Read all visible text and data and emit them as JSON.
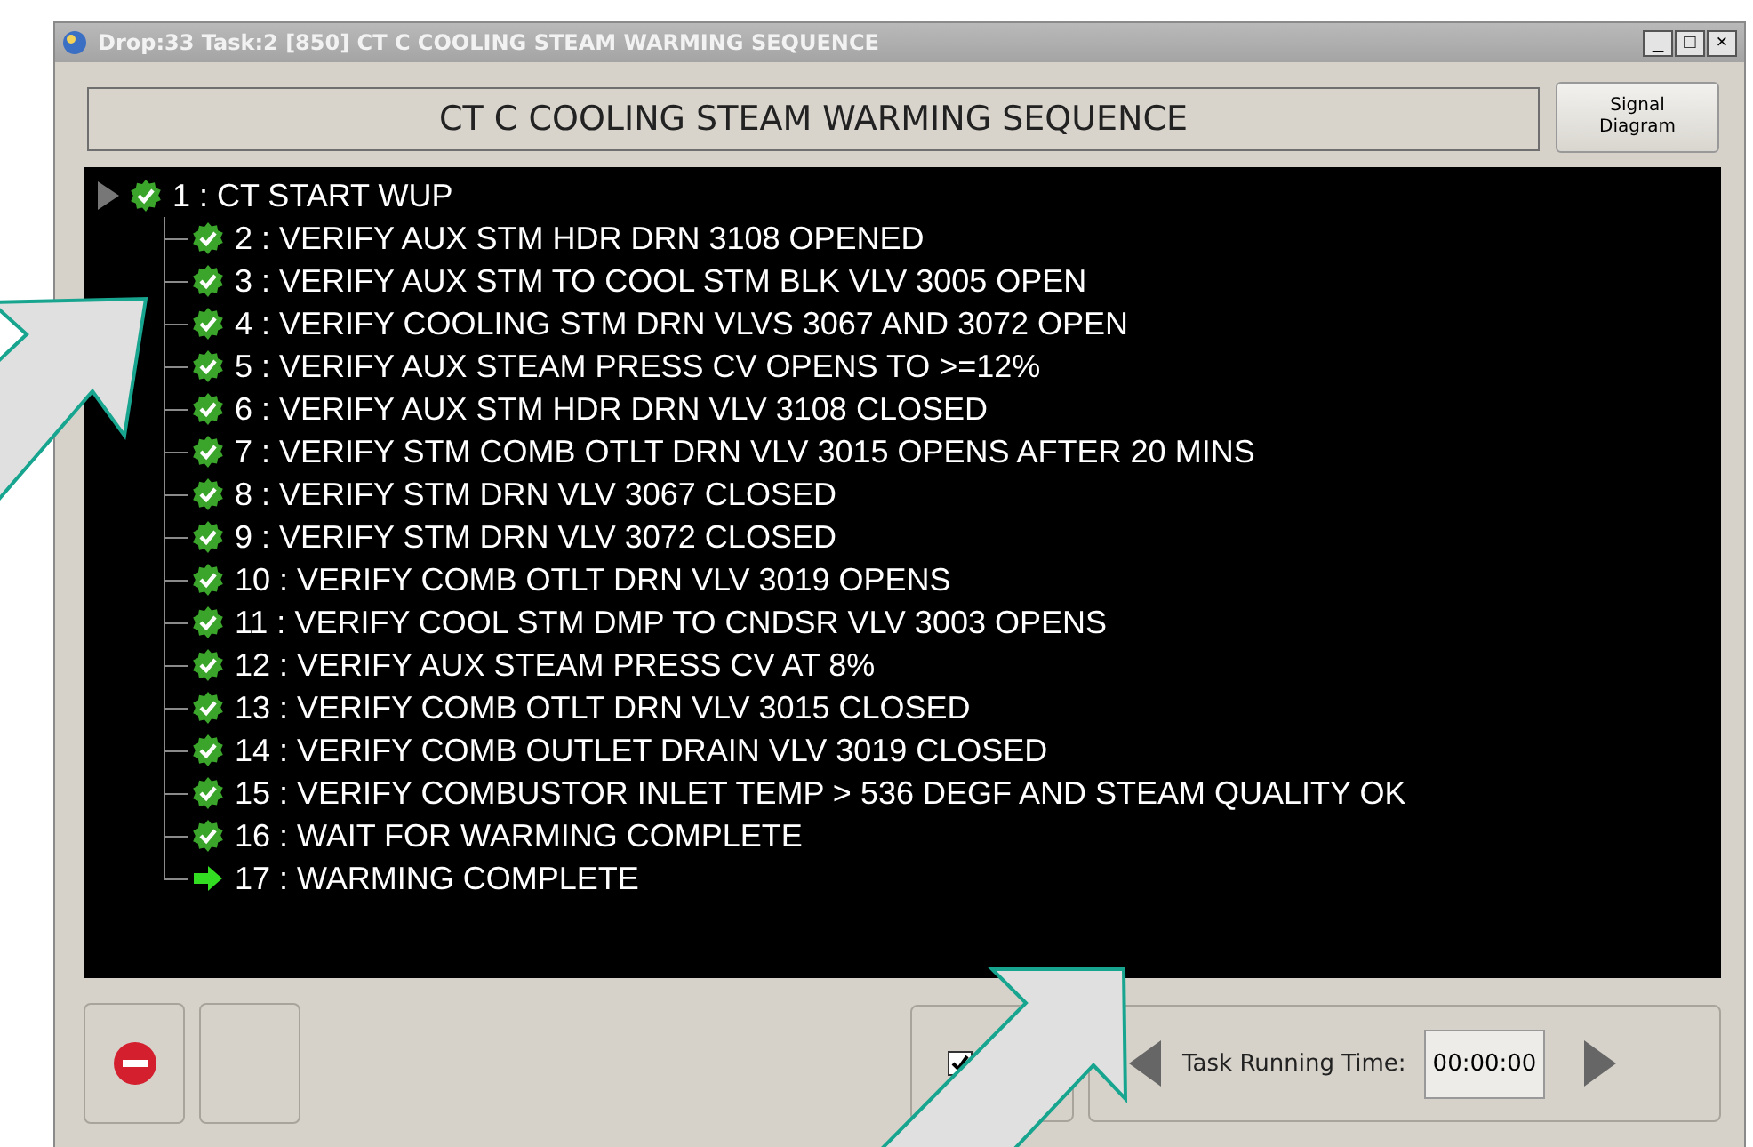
{
  "window": {
    "title": "Drop:33 Task:2 [850] CT C COOLING STEAM WARMING SEQUENCE",
    "controls": [
      "_",
      "□",
      "×"
    ]
  },
  "header": {
    "title": "CT C COOLING STEAM WARMING SEQUENCE",
    "button": "Signal Diagram"
  },
  "tree": [
    {
      "label": "1 : CT START WUP",
      "kind": "done",
      "expanded": true,
      "children": [
        {
          "label": "2 : VERIFY AUX STM HDR DRN 3108 OPENED",
          "kind": "done"
        },
        {
          "label": "3 : VERIFY AUX STM TO COOL STM BLK VLV 3005 OPEN",
          "kind": "done"
        },
        {
          "label": "4 : VERIFY COOLING STM DRN VLVS 3067 AND 3072 OPEN",
          "kind": "done"
        },
        {
          "label": "5 : VERIFY AUX STEAM PRESS CV OPENS TO >=12%",
          "kind": "done"
        },
        {
          "label": "6 : VERIFY AUX STM HDR DRN VLV 3108 CLOSED",
          "kind": "done"
        },
        {
          "label": "7 : VERIFY STM COMB OTLT DRN VLV 3015 OPENS AFTER 20 MINS",
          "kind": "done"
        },
        {
          "label": "8 : VERIFY STM DRN VLV 3067 CLOSED",
          "kind": "done"
        },
        {
          "label": "9 : VERIFY STM DRN VLV 3072 CLOSED",
          "kind": "done"
        },
        {
          "label": "10 : VERIFY COMB OTLT DRN VLV 3019 OPENS",
          "kind": "done"
        },
        {
          "label": "11 : VERIFY COOL STM DMP TO CNDSR VLV 3003 OPENS",
          "kind": "done"
        },
        {
          "label": "12 : VERIFY AUX STEAM PRESS CV AT 8%",
          "kind": "done"
        },
        {
          "label": "13 : VERIFY COMB OTLT DRN VLV 3015 CLOSED",
          "kind": "done"
        },
        {
          "label": "14 : VERIFY COMB OUTLET DRAIN VLV 3019 CLOSED",
          "kind": "done"
        },
        {
          "label": "15 : VERIFY COMBUSTOR INLET TEMP > 536 DEGF AND STEAM QUALITY OK",
          "kind": "done"
        },
        {
          "label": "16 : WAIT FOR WARMING COMPLETE",
          "kind": "done"
        },
        {
          "label": "17 : WARMING COMPLETE",
          "kind": "active"
        }
      ]
    }
  ],
  "footer": {
    "checkbox": {
      "checked": true
    },
    "time_label": "Task Running Time:",
    "time_value": "00:00:00"
  },
  "annotations": [
    {
      "kind": "arrow"
    },
    {
      "kind": "arrow"
    }
  ]
}
